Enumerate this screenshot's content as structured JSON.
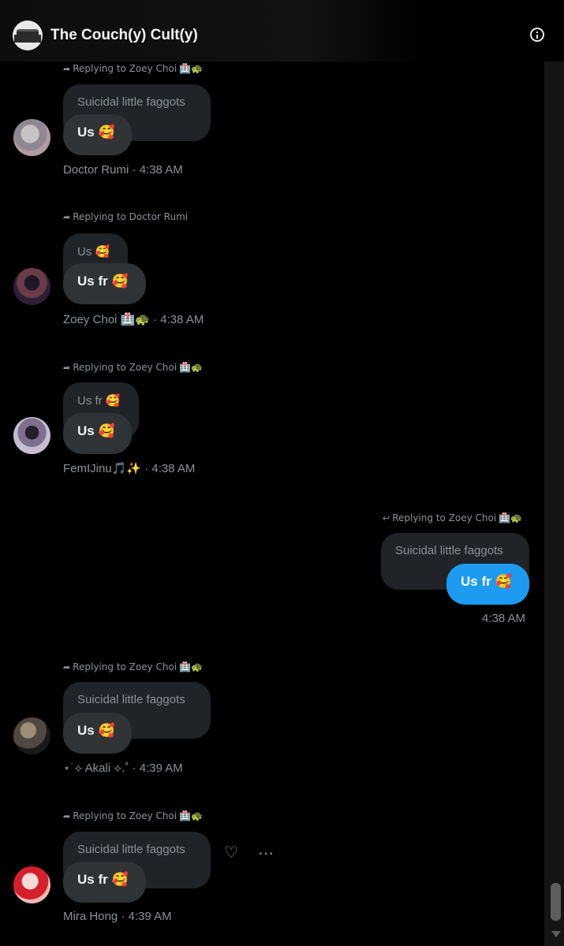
{
  "header": {
    "title": "The Couch(y) Cult(y)"
  },
  "messages": [
    {
      "reply_label": "Replying to Zoey Choi",
      "reply_tag": "🏥🐢",
      "quoted": "Suicidal little faggots",
      "text": "Us 🥰",
      "author": "Doctor Rumi",
      "time": "· 4:38 AM"
    },
    {
      "reply_label": "Replying to Doctor Rumi",
      "reply_tag": "",
      "quoted": "Us 🥰",
      "text": "Us fr 🥰",
      "author": "Zoey Choi 🏥🐢",
      "time": "· 4:38 AM"
    },
    {
      "reply_label": "Replying to Zoey Choi",
      "reply_tag": "🏥🐢",
      "quoted": "Us fr 🥰",
      "text": "Us 🥰",
      "author": "FemIJinu🎵✨",
      "time": "· 4:38 AM"
    },
    {
      "reply_label": "Replying to Zoey Choi",
      "reply_tag": "🏥🐢",
      "quoted": "Suicidal little faggots",
      "text": "Us fr 🥰",
      "author": "",
      "time": "4:38 AM"
    },
    {
      "reply_label": "Replying to Zoey Choi",
      "reply_tag": "🏥🐢",
      "quoted": "Suicidal little faggots",
      "text": "Us 🥰",
      "author": "⋆˙⟡ Akali ⟡.˚",
      "time": "· 4:39 AM"
    },
    {
      "reply_label": "Replying to Zoey Choi",
      "reply_tag": "🏥🐢",
      "quoted": "Suicidal little faggots",
      "text": "Us fr 🥰",
      "author": "Mira Hong",
      "time": "· 4:39 AM"
    }
  ],
  "icons": {
    "reply": "arrow-reply-icon",
    "info": "info-icon",
    "heart_add": "heart-add-icon",
    "more": "more-icon"
  },
  "colors": {
    "background": "#000000",
    "bubble": "#2f3336",
    "quoted_bubble": "#202327",
    "my_bubble": "#1d9bf0",
    "muted_text": "#8b9197"
  }
}
